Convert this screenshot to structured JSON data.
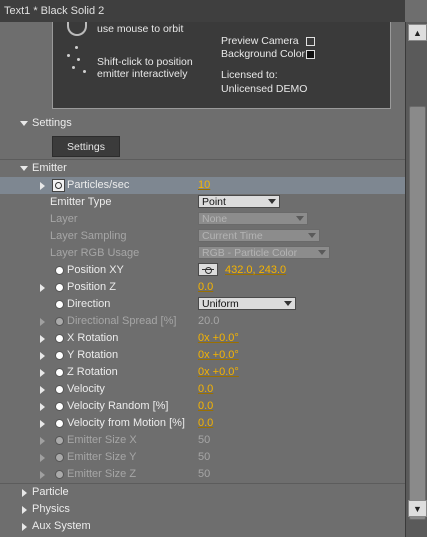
{
  "window": {
    "title": "Text1 * Black Solid 2"
  },
  "infobox": {
    "orbit_text": "use mouse to orbit",
    "shift_line1": "Shift-click to position",
    "shift_line2": "emitter interactively",
    "preview_camera": "Preview Camera",
    "background_color": "Background Color",
    "licensed_to": "Licensed to:",
    "license_name": "Unlicensed DEMO",
    "preview_camera_checked": false,
    "background_color_checked": true
  },
  "settings_section": {
    "label": "Settings",
    "button": "Settings"
  },
  "emitter_section": {
    "label": "Emitter"
  },
  "params": {
    "particles_sec": {
      "label": "Particles/sec",
      "value": "10"
    },
    "emitter_type": {
      "label": "Emitter Type",
      "value": "Point"
    },
    "layer": {
      "label": "Layer",
      "value": "None"
    },
    "layer_sampling": {
      "label": "Layer Sampling",
      "value": "Current Time"
    },
    "layer_rgb_usage": {
      "label": "Layer RGB Usage",
      "value": "RGB - Particle Color"
    },
    "position_xy": {
      "label": "Position XY",
      "value": "432.0, 243.0"
    },
    "position_z": {
      "label": "Position Z",
      "value": "0.0"
    },
    "direction": {
      "label": "Direction",
      "value": "Uniform"
    },
    "directional_spread": {
      "label": "Directional Spread [%]",
      "value": "20.0"
    },
    "x_rotation": {
      "label": "X Rotation",
      "value": "0x +0.0°"
    },
    "y_rotation": {
      "label": "Y Rotation",
      "value": "0x +0.0°"
    },
    "z_rotation": {
      "label": "Z Rotation",
      "value": "0x +0.0°"
    },
    "velocity": {
      "label": "Velocity",
      "value": "0.0"
    },
    "velocity_random": {
      "label": "Velocity Random [%]",
      "value": "0.0"
    },
    "velocity_from_motion": {
      "label": "Velocity from Motion [%]",
      "value": "0.0"
    },
    "emitter_size_x": {
      "label": "Emitter Size X",
      "value": "50"
    },
    "emitter_size_y": {
      "label": "Emitter Size Y",
      "value": "50"
    },
    "emitter_size_z": {
      "label": "Emitter Size Z",
      "value": "50"
    }
  },
  "collapsed_sections": {
    "particle": "Particle",
    "physics": "Physics",
    "aux_system": "Aux System"
  }
}
